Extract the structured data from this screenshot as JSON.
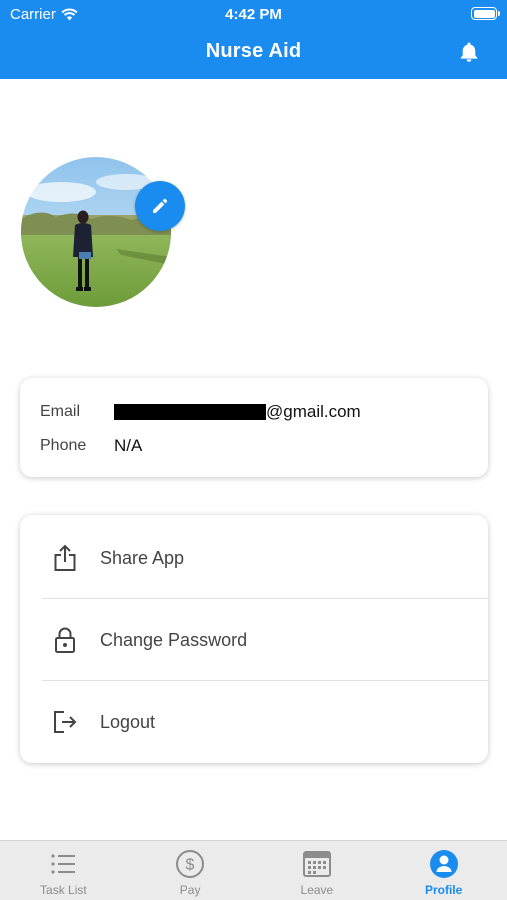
{
  "status_bar": {
    "carrier": "Carrier",
    "time": "4:42 PM"
  },
  "header": {
    "title": "Nurse Aid",
    "notification_icon": "bell-icon"
  },
  "profile": {
    "avatar_icon": "profile-photo",
    "edit_icon": "pencil-icon",
    "email_label": "Email",
    "email_value": "@gmail.com",
    "phone_label": "Phone",
    "phone_value": "N/A"
  },
  "menu": {
    "items": [
      {
        "label": "Share App",
        "icon": "share-icon"
      },
      {
        "label": "Change Password",
        "icon": "lock-icon"
      },
      {
        "label": "Logout",
        "icon": "logout-icon"
      }
    ]
  },
  "tabbar": {
    "tabs": [
      {
        "label": "Task List",
        "icon": "list-icon",
        "active": false
      },
      {
        "label": "Pay",
        "icon": "dollar-icon",
        "active": false
      },
      {
        "label": "Leave",
        "icon": "calendar-icon",
        "active": false
      },
      {
        "label": "Profile",
        "icon": "person-icon",
        "active": true
      }
    ]
  },
  "colors": {
    "primary": "#1a8cf0",
    "inactive": "#8c8c8c",
    "tabbar_bg": "#ebebeb"
  }
}
